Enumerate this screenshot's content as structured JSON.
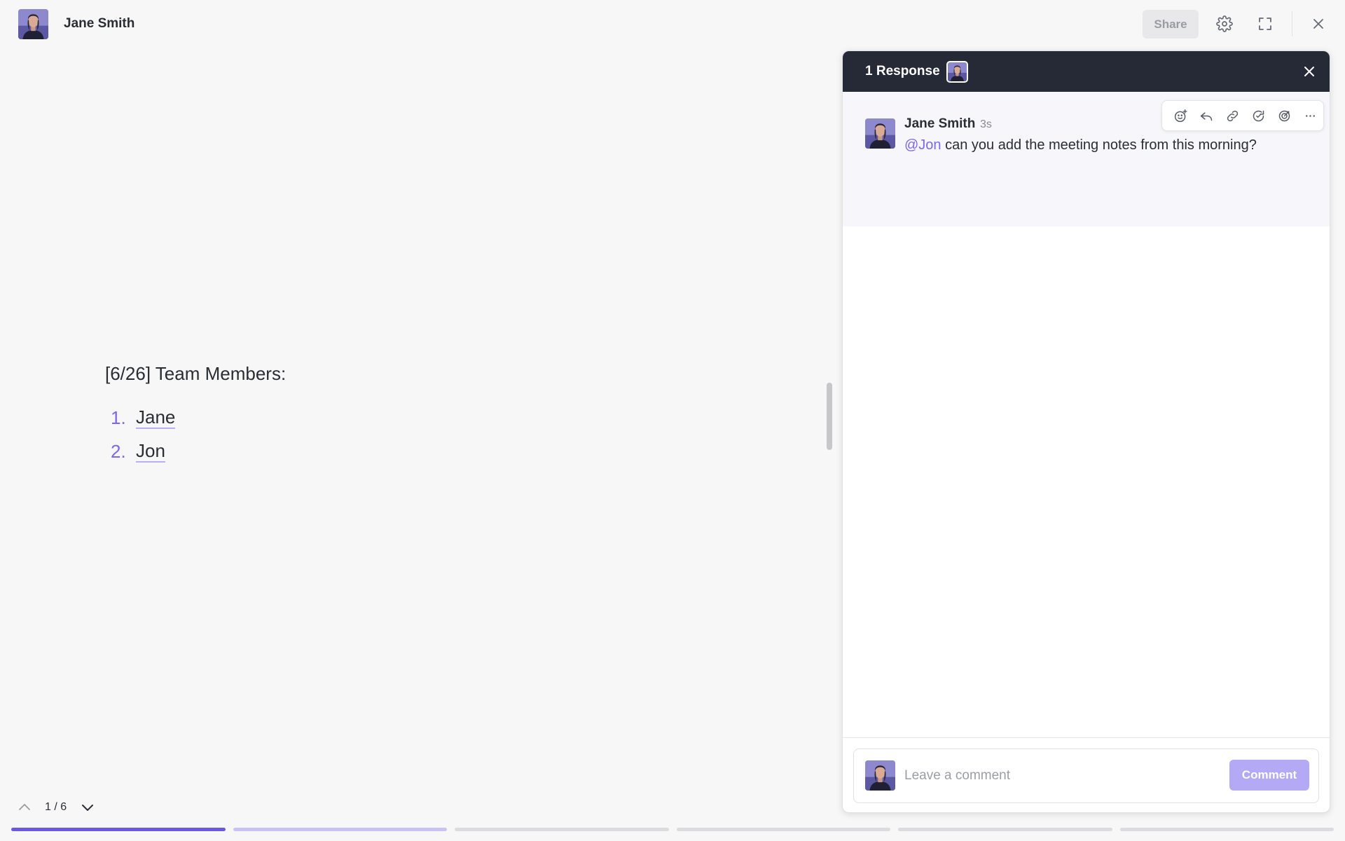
{
  "header": {
    "user_name": "Jane Smith",
    "share_label": "Share",
    "icons": [
      "gear-icon",
      "expand-icon",
      "close-icon"
    ]
  },
  "document": {
    "title": "[6/26] Team Members:",
    "list": [
      {
        "number": "1.",
        "text": "Jane"
      },
      {
        "number": "2.",
        "text": "Jon"
      }
    ]
  },
  "pager": {
    "current_label": "1 / 6",
    "total_pages": 6,
    "current_page": 1
  },
  "panel": {
    "header_title": "1 Response",
    "comment": {
      "author": "Jane Smith",
      "time": "3s",
      "mention": "@Jon",
      "text": " can you add the meeting notes from this morning?"
    },
    "actions": [
      "add-reaction-icon",
      "reply-icon",
      "link-icon",
      "reopen-icon",
      "assign-icon",
      "more-icon"
    ],
    "composer": {
      "placeholder": "Leave a comment",
      "button_label": "Comment"
    }
  },
  "colors": {
    "accent": "#7b68ee",
    "panel_header": "#262a36",
    "background": "#f7f7f8"
  }
}
